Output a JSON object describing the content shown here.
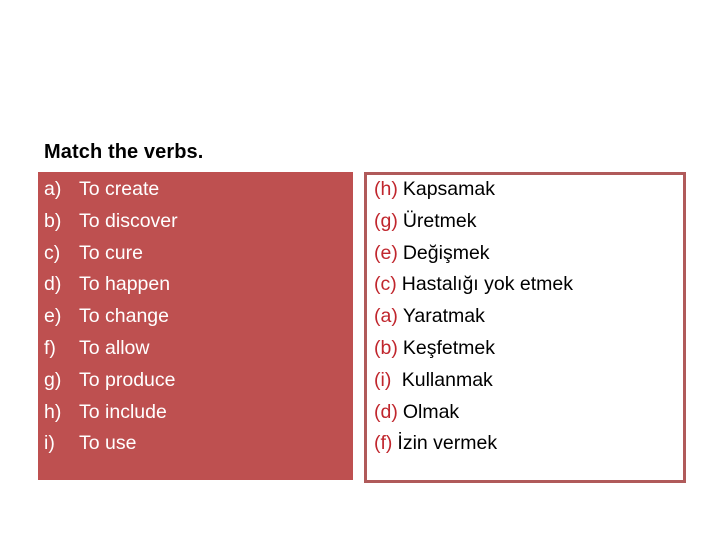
{
  "title": "Match the verbs.",
  "colors": {
    "left_box_bg": "#be5050",
    "right_box_border": "#b05a5a",
    "answer_key": "#c0262d"
  },
  "verbs": [
    {
      "letter": "a)",
      "text": "To create"
    },
    {
      "letter": "b)",
      "text": "To discover"
    },
    {
      "letter": "c)",
      "text": "To cure"
    },
    {
      "letter": "d)",
      "text": "To happen"
    },
    {
      "letter": "e)",
      "text": "To change"
    },
    {
      "letter": "f)",
      "text": "To allow"
    },
    {
      "letter": "g)",
      "text": "To produce"
    },
    {
      "letter": "h)",
      "text": "To include"
    },
    {
      "letter": "i)",
      "text": "To use"
    }
  ],
  "translations": [
    {
      "key": "(h)",
      "text": "Kapsamak"
    },
    {
      "key": "(g)",
      "text": "Üretmek"
    },
    {
      "key": "(e)",
      "text": "Değişmek"
    },
    {
      "key": "(c)",
      "text": "Hastalığı yok etmek"
    },
    {
      "key": "(a)",
      "text": "Yaratmak"
    },
    {
      "key": "(b)",
      "text": "Keşfetmek"
    },
    {
      "key": "(i)",
      "text": " Kullanmak"
    },
    {
      "key": "(d)",
      "text": "Olmak"
    },
    {
      "key": "(f)",
      "text": "İzin vermek"
    }
  ]
}
